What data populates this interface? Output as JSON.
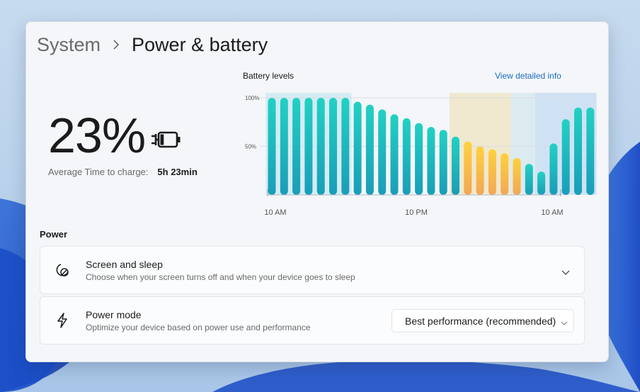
{
  "breadcrumb": {
    "parent": "System",
    "current": "Power & battery"
  },
  "battery": {
    "percent": "23%",
    "charge_label": "Average Time to charge:",
    "charge_value": "5h 23min",
    "level_fraction": 0.23
  },
  "chart_header": {
    "title": "Battery levels",
    "link": "View detailed info"
  },
  "chart_data": {
    "type": "bar",
    "title": "Battery levels",
    "xlabel": "",
    "ylabel": "",
    "y_ticks": [
      "100%",
      "50%"
    ],
    "x_ticks": [
      "10 AM",
      "10 PM",
      "10 AM"
    ],
    "ylim": [
      0,
      100
    ],
    "values": [
      100,
      100,
      100,
      100,
      100,
      100,
      100,
      96,
      93,
      88,
      83,
      79,
      74,
      70,
      67,
      60,
      55,
      50,
      47,
      43,
      38,
      32,
      24,
      53,
      78,
      90,
      90
    ],
    "states": [
      "normal",
      "normal",
      "normal",
      "normal",
      "normal",
      "normal",
      "normal",
      "normal",
      "normal",
      "normal",
      "normal",
      "normal",
      "normal",
      "normal",
      "normal",
      "normal",
      "saver",
      "saver",
      "saver",
      "saver",
      "saver",
      "normal",
      "normal",
      "charging",
      "charging",
      "charging",
      "charging"
    ],
    "colors": {
      "normal": "#1bb5b0",
      "saver": "#f7c64a",
      "charging": "#1bb5b0"
    },
    "highlight_bands": [
      {
        "label": "full",
        "from_bar": 0,
        "to_bar": 6,
        "color": "#d4ecf3"
      },
      {
        "label": "battery-saver",
        "from_bar": 15,
        "to_bar": 20,
        "color": "#f0e8cf"
      },
      {
        "label": "idle",
        "from_bar": 20,
        "to_bar": 22,
        "color": "#dcebef"
      },
      {
        "label": "charging",
        "from_bar": 22,
        "to_bar": 26,
        "color": "#cfe2f4"
      }
    ]
  },
  "power": {
    "section_title": "Power",
    "screen_sleep": {
      "title": "Screen and sleep",
      "subtitle": "Choose when your screen turns off and when your device goes to sleep"
    },
    "power_mode": {
      "title": "Power mode",
      "subtitle": "Optimize your device based on power use and performance",
      "selected": "Best performance (recommended)"
    }
  },
  "icons": [
    "chevron-right-icon",
    "battery-charging-icon",
    "screen-sleep-icon",
    "lightning-icon",
    "chevron-down-icon"
  ]
}
